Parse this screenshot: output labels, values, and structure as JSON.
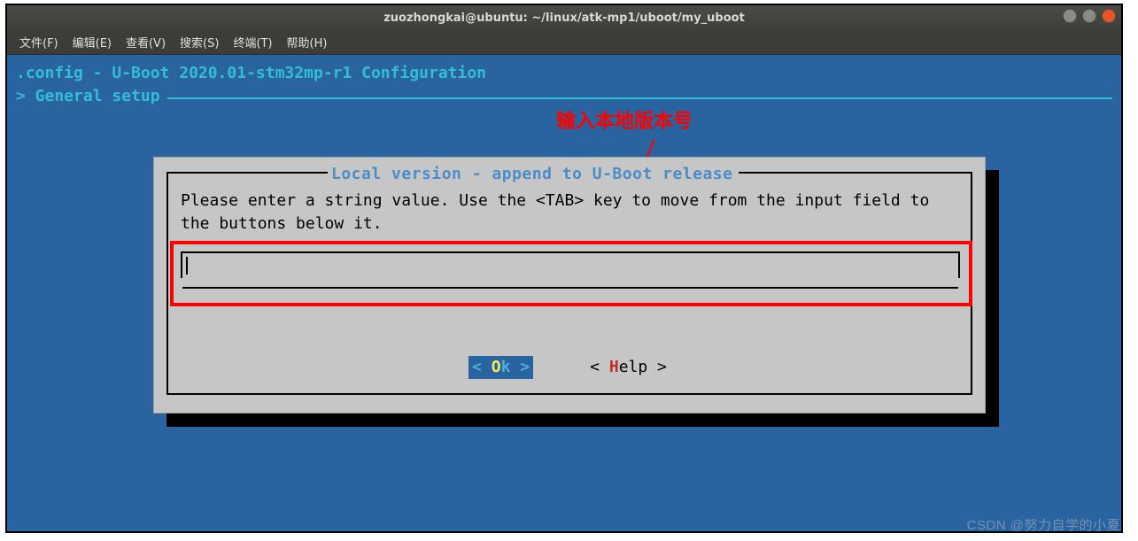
{
  "window": {
    "title": "zuozhongkai@ubuntu: ~/linux/atk-mp1/uboot/my_uboot"
  },
  "menu": {
    "file": "文件(F)",
    "edit": "编辑(E)",
    "view": "查看(V)",
    "search": "搜索(S)",
    "terminal": "终端(T)",
    "help": "帮助(H)"
  },
  "config": {
    "header": ".config - U-Boot 2020.01-stm32mp-r1 Configuration",
    "breadcrumb": "> General setup"
  },
  "dialog": {
    "title": "Local version - append to U-Boot release",
    "prompt": "Please enter a string value. Use the <TAB> key to move from the input field to the buttons below it.",
    "input_value": "",
    "ok_bracket_l": "<  ",
    "ok_hot": "O",
    "ok_rest": "k",
    "ok_bracket_r": "  >",
    "help_bracket_l": "< ",
    "help_hot": "H",
    "help_rest": "elp",
    "help_bracket_r": " >"
  },
  "annotation": {
    "label": "输入本地版本号"
  },
  "watermark": "CSDN @努力自学的小夏"
}
